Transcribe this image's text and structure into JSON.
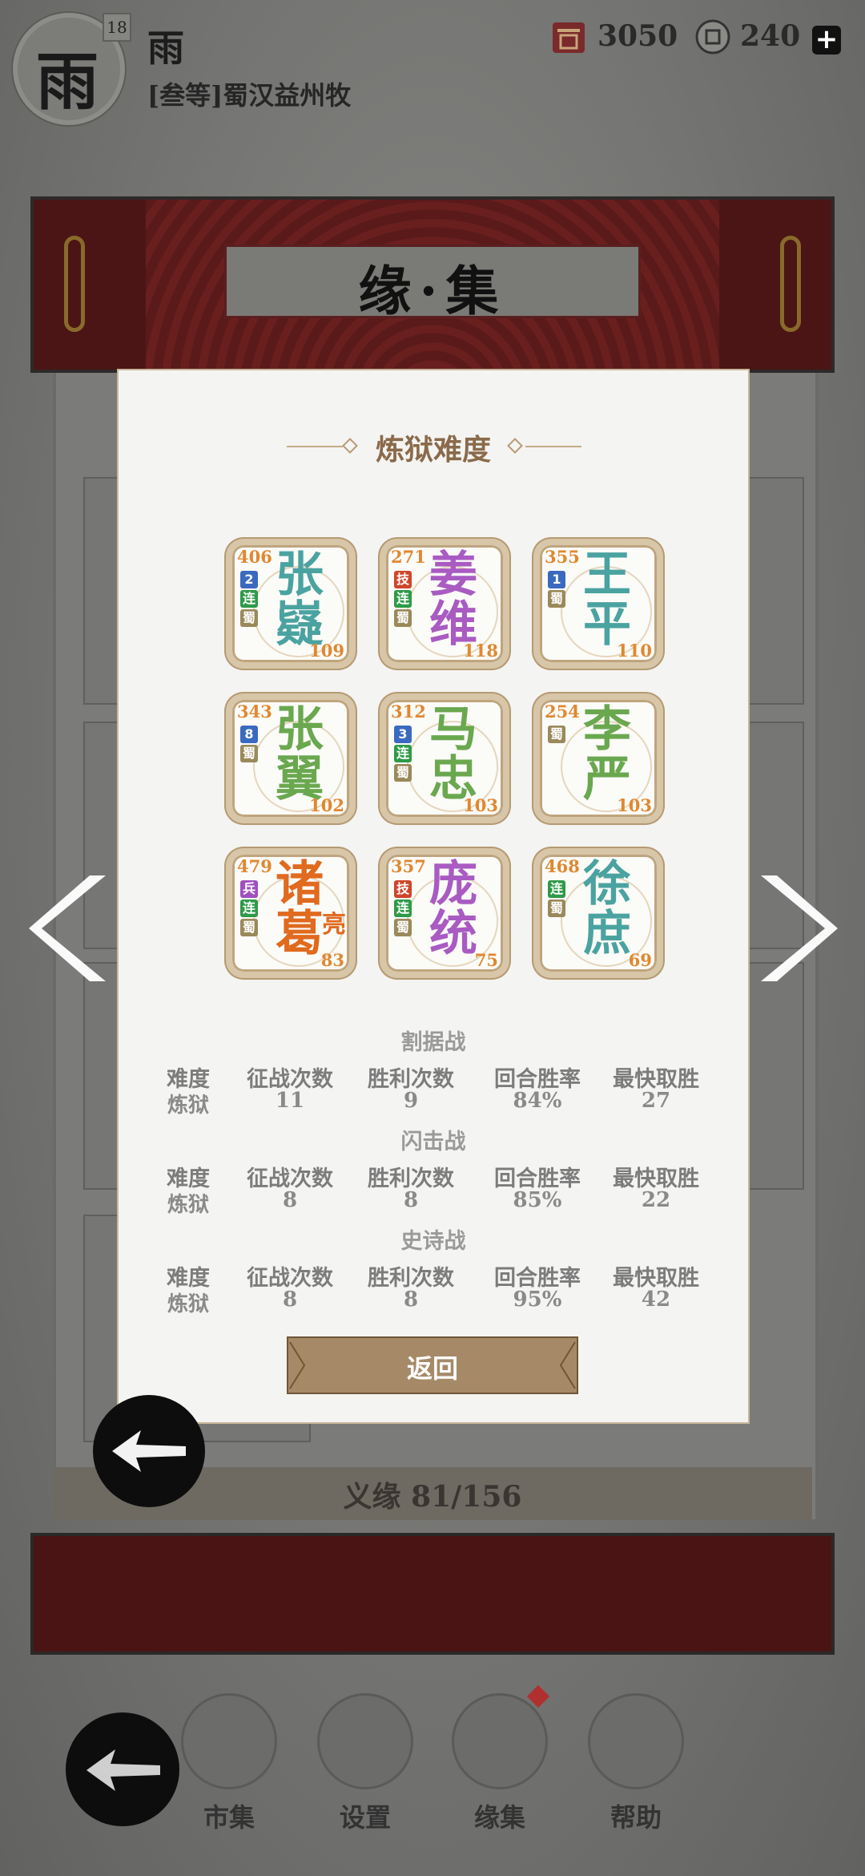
{
  "header": {
    "avatar_char": "雨",
    "level": "18",
    "name": "雨",
    "rank": "[叁等]蜀汉益州牧",
    "resource1": {
      "icon": "token-icon",
      "value": "3050"
    },
    "resource2": {
      "icon": "coin-icon",
      "value": "240"
    },
    "plus_label": "+"
  },
  "page": {
    "title": "缘·集",
    "footer": "义缘  81/156"
  },
  "modal": {
    "title": "炼狱难度",
    "cards": [
      {
        "name": "张\n嶷",
        "top": "406",
        "bottom": "109",
        "color": "#4aa3a0",
        "tags": [
          {
            "t": "2",
            "c": "blue"
          },
          {
            "t": "连",
            "c": "green"
          },
          {
            "t": "蜀",
            "c": "olive"
          }
        ],
        "extra": ""
      },
      {
        "name": "姜\n维",
        "top": "271",
        "bottom": "118",
        "color": "#a95bc2",
        "tags": [
          {
            "t": "技",
            "c": "red"
          },
          {
            "t": "连",
            "c": "green"
          },
          {
            "t": "蜀",
            "c": "olive"
          }
        ],
        "extra": ""
      },
      {
        "name": "王\n平",
        "top": "355",
        "bottom": "110",
        "color": "#4aa3a0",
        "tags": [
          {
            "t": "1",
            "c": "blue"
          },
          {
            "t": "蜀",
            "c": "olive"
          }
        ],
        "extra": ""
      },
      {
        "name": "张\n翼",
        "top": "343",
        "bottom": "102",
        "color": "#6aa84f",
        "tags": [
          {
            "t": "8",
            "c": "blue"
          },
          {
            "t": "蜀",
            "c": "olive"
          }
        ],
        "extra": ""
      },
      {
        "name": "马\n忠",
        "top": "312",
        "bottom": "103",
        "color": "#6aa84f",
        "tags": [
          {
            "t": "3",
            "c": "blue"
          },
          {
            "t": "连",
            "c": "green"
          },
          {
            "t": "蜀",
            "c": "olive"
          }
        ],
        "extra": ""
      },
      {
        "name": "李\n严",
        "top": "254",
        "bottom": "103",
        "color": "#6aa84f",
        "tags": [
          {
            "t": "蜀",
            "c": "olive"
          }
        ],
        "extra": ""
      },
      {
        "name": "诸\n葛",
        "top": "479",
        "bottom": "83",
        "color": "#e06a1e",
        "tags": [
          {
            "t": "兵",
            "c": "purple"
          },
          {
            "t": "连",
            "c": "green"
          },
          {
            "t": "蜀",
            "c": "olive"
          }
        ],
        "extra": "亮"
      },
      {
        "name": "庞\n统",
        "top": "357",
        "bottom": "75",
        "color": "#a95bc2",
        "tags": [
          {
            "t": "技",
            "c": "red"
          },
          {
            "t": "连",
            "c": "green"
          },
          {
            "t": "蜀",
            "c": "olive"
          }
        ],
        "extra": ""
      },
      {
        "name": "徐\n庶",
        "top": "468",
        "bottom": "69",
        "color": "#4aa3a0",
        "tags": [
          {
            "t": "连",
            "c": "green"
          },
          {
            "t": "蜀",
            "c": "olive"
          }
        ],
        "extra": ""
      }
    ],
    "stat_columns": [
      "难度",
      "征战次数",
      "胜利次数",
      "回合胜率",
      "最快取胜"
    ],
    "stats": [
      {
        "mode": "割据战",
        "values": [
          "炼狱",
          "11",
          "9",
          "84%",
          "27"
        ]
      },
      {
        "mode": "闪击战",
        "values": [
          "炼狱",
          "8",
          "8",
          "85%",
          "22"
        ]
      },
      {
        "mode": "史诗战",
        "values": [
          "炼狱",
          "8",
          "8",
          "95%",
          "42"
        ]
      }
    ],
    "back_label": "返回"
  },
  "nav": {
    "items": [
      {
        "label": "市集",
        "icon": "market-icon"
      },
      {
        "label": "设置",
        "icon": "settings-icon"
      },
      {
        "label": "缘集",
        "icon": "collection-icon"
      },
      {
        "label": "帮助",
        "icon": "help-icon"
      }
    ]
  }
}
